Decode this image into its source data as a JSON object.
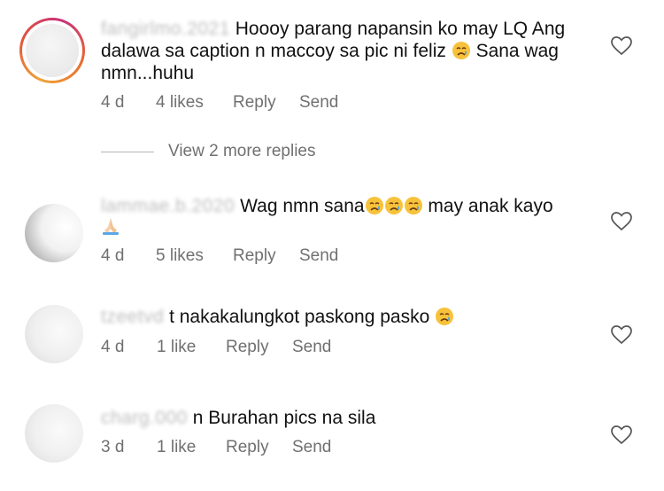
{
  "comments": [
    {
      "username": "fangirlmo.2021",
      "text_line1": "Hoooy parang napansin ko may LQ Ang",
      "text_line2": "dalawa sa caption n maccoy sa pic ni feliz",
      "text_line2_after": "Sana wag",
      "text_line3": "nmn...huhu",
      "time": "4 d",
      "likes": "4 likes",
      "reply": "Reply",
      "send": "Send"
    },
    {
      "username": "lammae.b.2020",
      "text_a": "Wag nmn sana",
      "text_b": "may anak kayo",
      "time": "4 d",
      "likes": "5 likes",
      "reply": "Reply",
      "send": "Send"
    },
    {
      "username": "tzeetvd",
      "text": "t nakakalungkot paskong pasko",
      "time": "4 d",
      "likes": "1 like",
      "reply": "Reply",
      "send": "Send"
    },
    {
      "username": "charg.000",
      "text": "n Burahan pics na sila",
      "time": "3 d",
      "likes": "1 like",
      "reply": "Reply",
      "send": "Send"
    }
  ],
  "view_more": "View 2 more replies",
  "icons": {
    "heart": "heart-outline-icon",
    "crying": "crying-face-emoji",
    "pray": "folded-hands-emoji"
  },
  "colors": {
    "meta_text": "#707070",
    "ring_gradient": [
      "#f0a23a",
      "#e2553a",
      "#c92f7a"
    ]
  }
}
